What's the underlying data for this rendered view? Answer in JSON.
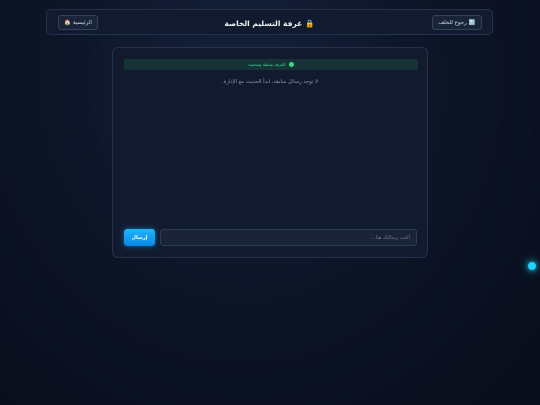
{
  "header": {
    "title": "غرفة التسليم الخاصة",
    "lock_icon": "🔒",
    "home_button": {
      "label": "الرئيسية",
      "icon": "🏠"
    },
    "back_button": {
      "label": "رجوع للخلف",
      "icon": "🔙"
    }
  },
  "chat": {
    "status_text": "الغرفة نشطة ومحمية",
    "status_color": "#39d98a",
    "empty_message": "لا توجد رسائل سابقة، ابدأ الحديث مع الإدارة.",
    "input_placeholder": "اكتب رسالتك هنا...",
    "send_label": "إرسال"
  },
  "colors": {
    "accent": "#1fb6ff",
    "floating_indicator": "#1fd2ff"
  }
}
